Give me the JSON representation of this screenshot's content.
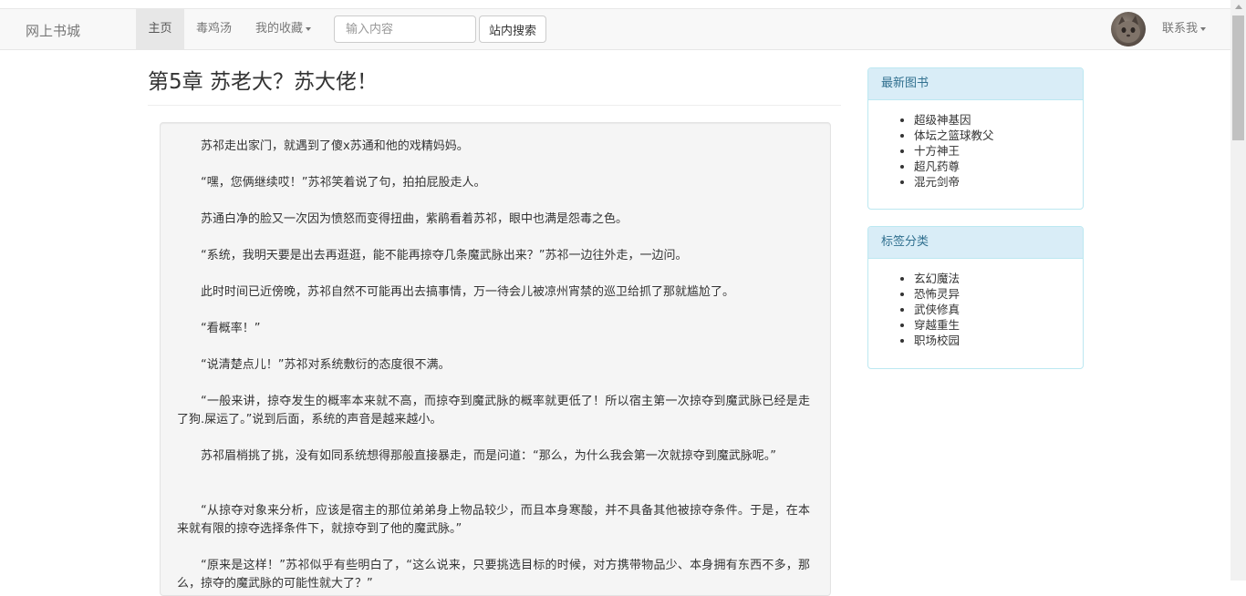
{
  "nav": {
    "brand": "网上书城",
    "items": [
      {
        "label": "主页",
        "active": true
      },
      {
        "label": "毒鸡汤",
        "active": false
      },
      {
        "label": "我的收藏",
        "dropdown": true
      }
    ],
    "search_placeholder": "输入内容",
    "search_button": "站内搜索",
    "contact_label": "联系我"
  },
  "chapter": {
    "title": "第5章 苏老大？苏大佬！",
    "paragraphs": [
      "苏祁走出家门，就遇到了傻x苏通和他的戏精妈妈。",
      "“嘿，您俩继续哎！”苏祁笑着说了句，拍拍屁股走人。",
      "苏通白净的脸又一次因为愤怒而变得扭曲，紫鹃看着苏祁，眼中也满是怨毒之色。",
      "“系统，我明天要是出去再逛逛，能不能再掠夺几条魔武脉出来？”苏祁一边往外走，一边问。",
      "此时时间已近傍晚，苏祁自然不可能再出去搞事情，万一待会儿被凉州宵禁的巡卫给抓了那就尴尬了。",
      "“看概率！”",
      "“说清楚点儿！”苏祁对系统敷衍的态度很不满。",
      "“一般来讲，掠夺发生的概率本来就不高，而掠夺到魔武脉的概率就更低了！所以宿主第一次掠夺到魔武脉已经是走了狗.屎运了。”说到后面，系统的声音是越来越小。",
      "苏祁眉梢挑了挑，没有如同系统想得那般直接暴走，而是问道：“那么，为什么我会第一次就掠夺到魔武脉呢。”",
      "“从掠夺对象来分析，应该是宿主的那位弟弟身上物品较少，而且本身寒酸，并不具备其他被掠夺条件。于是，在本来就有限的掠夺选择条件下，就掠夺到了他的魔武脉。”",
      "“原来是这样！”苏祁似乎有些明白了，“这么说来，只要挑选目标的时候，对方携带物品少、本身拥有东西不多，那么，掠夺的魔武脉的可能性就大了？”"
    ]
  },
  "sidebar": {
    "latest": {
      "heading": "最新图书",
      "books": [
        "超级神基因",
        "体坛之篮球教父",
        "十方神王",
        "超凡药尊",
        "混元剑帝"
      ]
    },
    "tags": {
      "heading": "标签分类",
      "items": [
        "玄幻魔法",
        "恐怖灵异",
        "武侠修真",
        "穿越重生",
        "职场校园"
      ]
    }
  },
  "colors": {
    "panel_heading_bg": "#d9edf7",
    "panel_heading_text": "#31708f",
    "panel_border": "#bce8f1",
    "navbar_bg": "#f8f8f8"
  }
}
